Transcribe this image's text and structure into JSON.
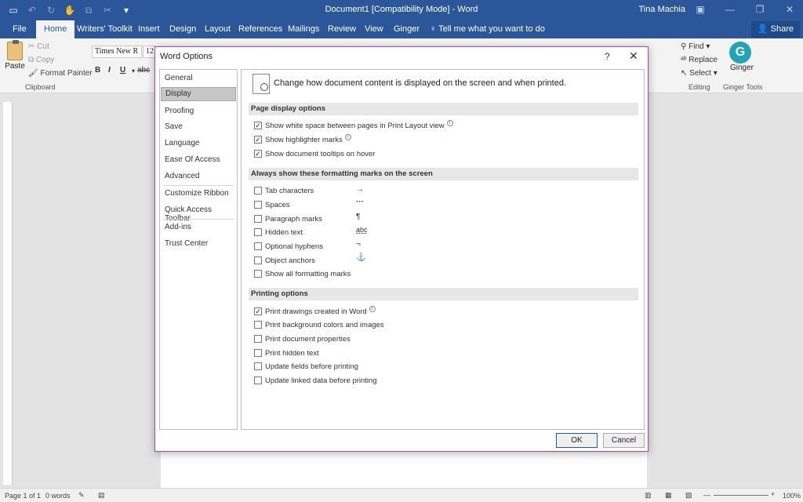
{
  "app": {
    "title": "Document1 [Compatibility Mode]  -  Word",
    "user": "Tina Machia",
    "qat": [
      "save-icon",
      "undo-icon",
      "redo-icon",
      "touch-mode-icon",
      "copy-icon",
      "cut-icon",
      "customize-qat-icon"
    ]
  },
  "tabs": [
    "File",
    "Home",
    "Writers' Toolkit",
    "Insert",
    "Design",
    "Layout",
    "References",
    "Mailings",
    "Review",
    "View",
    "Ginger"
  ],
  "tellme": "Tell me what you want to do",
  "share": "Share",
  "ribbon": {
    "paste": "Paste",
    "cut": "Cut",
    "copy": "Copy",
    "format_painter": "Format Painter",
    "clipboard_group": "Clipboard",
    "font_name": "Times New R",
    "font_size": "12",
    "find": "Find",
    "replace": "Replace",
    "select": "Select",
    "editing_group": "Editing",
    "ginger": "Ginger",
    "ginger_group": "Ginger Tools"
  },
  "statusbar": {
    "page": "Page 1 of 1",
    "words": "0 words",
    "zoom": "100%"
  },
  "dialog": {
    "title": "Word Options",
    "help": "?",
    "nav": [
      "General",
      "Display",
      "Proofing",
      "Save",
      "Language",
      "Ease Of Access",
      "Advanced",
      "Customize Ribbon",
      "Quick Access Toolbar",
      "Add-ins",
      "Trust Center"
    ],
    "selected_nav": "Display",
    "intro": "Change how document content is displayed on the screen and when printed.",
    "sections": {
      "page_display": {
        "heading": "Page display options",
        "options": [
          {
            "label": "Show white space between pages in Print Layout view",
            "checked": true,
            "info": true
          },
          {
            "label": "Show highlighter marks",
            "checked": true,
            "info": true
          },
          {
            "label": "Show document tooltips on hover",
            "checked": true,
            "info": false
          }
        ]
      },
      "formatting_marks": {
        "heading": "Always show these formatting marks on the screen",
        "options": [
          {
            "label": "Tab characters",
            "checked": false,
            "symbol": "→"
          },
          {
            "label": "Spaces",
            "checked": false,
            "symbol": "···"
          },
          {
            "label": "Paragraph marks",
            "checked": false,
            "symbol": "¶"
          },
          {
            "label": "Hidden text",
            "checked": false,
            "symbol": "abc"
          },
          {
            "label": "Optional hyphens",
            "checked": false,
            "symbol": "¬"
          },
          {
            "label": "Object anchors",
            "checked": false,
            "symbol": "⚓"
          },
          {
            "label": "Show all formatting marks",
            "checked": false,
            "symbol": ""
          }
        ]
      },
      "printing": {
        "heading": "Printing options",
        "options": [
          {
            "label": "Print drawings created in Word",
            "checked": true,
            "info": true
          },
          {
            "label": "Print background colors and images",
            "checked": false,
            "info": false
          },
          {
            "label": "Print document properties",
            "checked": false,
            "info": false
          },
          {
            "label": "Print hidden text",
            "checked": false,
            "info": false
          },
          {
            "label": "Update fields before printing",
            "checked": false,
            "info": false
          },
          {
            "label": "Update linked data before printing",
            "checked": false,
            "info": false
          }
        ]
      }
    },
    "ok": "OK",
    "cancel": "Cancel"
  },
  "colors": {
    "accent": "#2b579a",
    "dialog_border": "#a64ca6"
  }
}
